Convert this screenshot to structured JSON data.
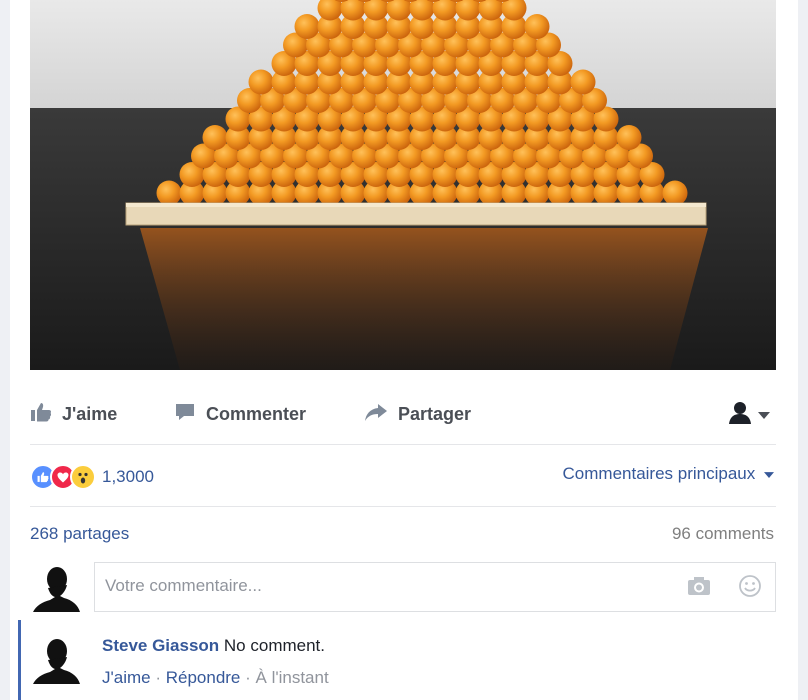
{
  "post_image": {
    "description_icon": "orange-pyramid-photo"
  },
  "actions": {
    "like_label": "J'aime",
    "comment_label": "Commenter",
    "share_label": "Partager",
    "like_icon": "thumbs-up-icon",
    "comment_icon": "speech-bubble-icon",
    "share_icon": "share-arrow-icon",
    "audience_icon": "person-silhouette-icon"
  },
  "reactions": {
    "icons": [
      "like-reaction-icon",
      "love-reaction-icon",
      "wow-reaction-icon"
    ],
    "count": "1,3000",
    "sort_label": "Commentaires principaux"
  },
  "stats": {
    "shares": "268 partages",
    "comments": "96 comments"
  },
  "composer": {
    "placeholder": "Votre commentaire...",
    "camera_icon": "camera-icon",
    "emoji_icon": "smiley-icon"
  },
  "comments": [
    {
      "author": "Steve Giasson",
      "text": "No comment.",
      "like_label": "J'aime",
      "reply_label": "Répondre",
      "time": "À l'instant"
    }
  ],
  "colors": {
    "link": "#365899",
    "action_text": "#4b4f56",
    "accent": "#4267b2",
    "orange": "#f08a1c"
  }
}
